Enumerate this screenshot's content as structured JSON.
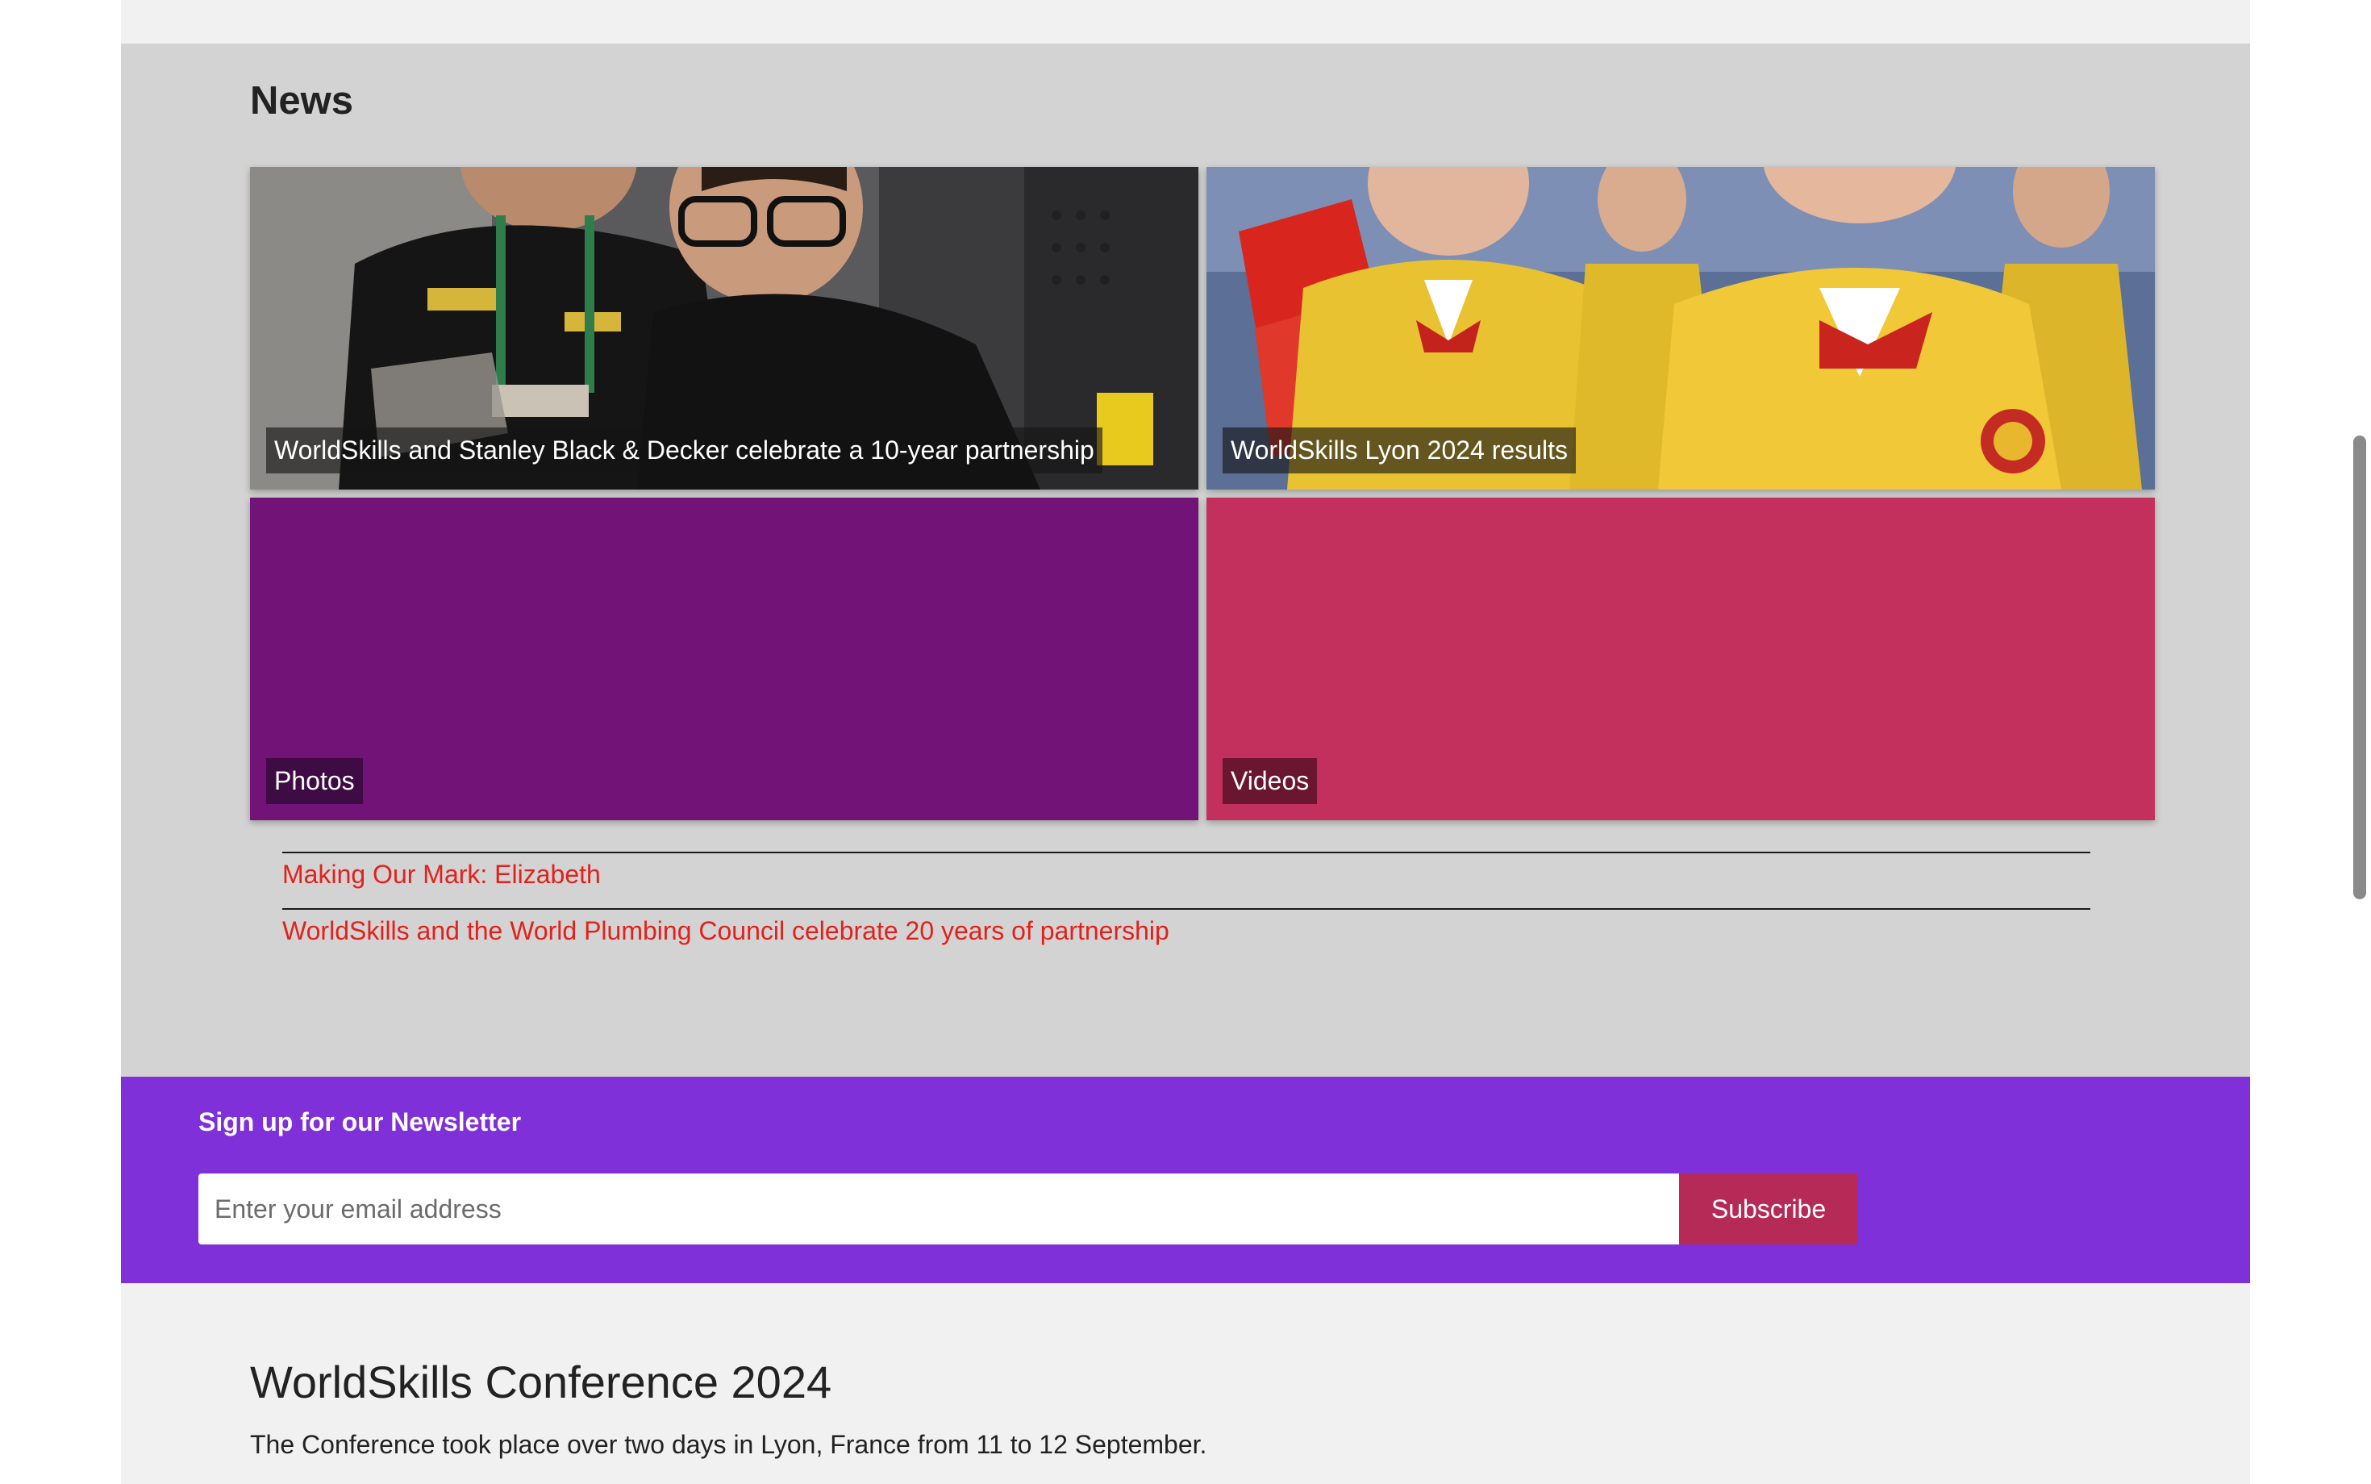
{
  "news": {
    "heading": "News",
    "tiles": [
      {
        "caption": "WorldSkills and Stanley Black & Decker celebrate a 10-year partnership",
        "image": "photo-workshop"
      },
      {
        "caption": "WorldSkills Lyon 2024 results",
        "image": "photo-team-yellow-jackets"
      },
      {
        "caption": "Photos",
        "color": "#721377"
      },
      {
        "caption": "Videos",
        "color": "#c4305d"
      }
    ],
    "links": [
      {
        "label": "Making Our Mark: Elizabeth"
      },
      {
        "label": "WorldSkills and the World Plumbing Council celebrate 20 years of partnership"
      }
    ]
  },
  "newsletter": {
    "title": "Sign up for our Newsletter",
    "email_placeholder": "Enter your email address",
    "email_value": "",
    "subscribe_label": "Subscribe"
  },
  "conference": {
    "title": "WorldSkills Conference 2024",
    "text": "The Conference took place over two days in Lyon, France from 11 to 12 September."
  },
  "colors": {
    "page_bg": "#f1f1f1",
    "news_bg": "#d3d3d3",
    "newsletter_bg": "#7f30d9",
    "subscribe_bg": "#b52a56",
    "link_color": "#e2211c"
  }
}
